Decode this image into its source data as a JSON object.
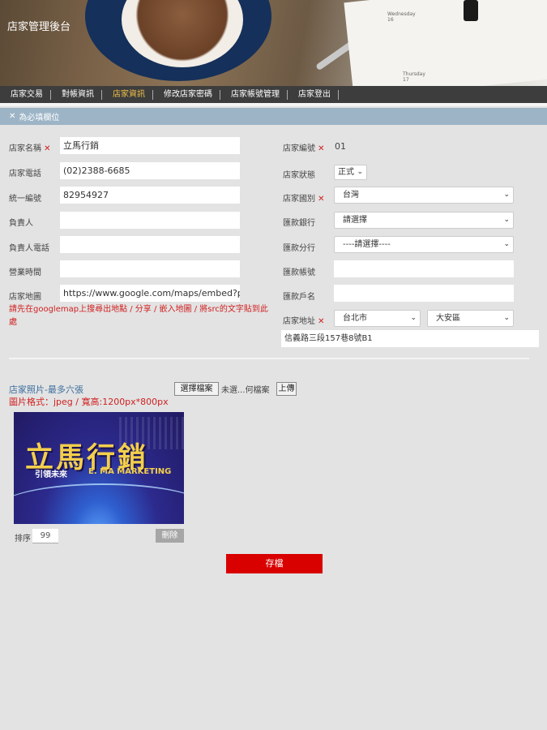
{
  "header": {
    "site_title": "店家管理後台",
    "calendar_text_1": "Wednesday\n16",
    "calendar_text_2": "Thursday\n17"
  },
  "nav": {
    "items": [
      {
        "label": "店家交易",
        "active": false
      },
      {
        "label": "對帳資訊",
        "active": false
      },
      {
        "label": "店家資訊",
        "active": true
      },
      {
        "label": "修改店家密碼",
        "active": false
      },
      {
        "label": "店家帳號管理",
        "active": false
      },
      {
        "label": "店家登出",
        "active": false
      }
    ]
  },
  "required_note": {
    "star": "✕",
    "text": "為必填欄位"
  },
  "form": {
    "store_name": {
      "label": "店家名稱",
      "value": "立馬行銷",
      "required": true
    },
    "store_phone": {
      "label": "店家電話",
      "value": "(02)2388-6685"
    },
    "tax_id": {
      "label": "統一編號",
      "value": "82954927"
    },
    "owner": {
      "label": "負責人",
      "value": ""
    },
    "owner_phone": {
      "label": "負責人電話",
      "value": ""
    },
    "hours": {
      "label": "營業時間",
      "value": ""
    },
    "map": {
      "label": "店家地圖",
      "value": "https://www.google.com/maps/embed?pb"
    },
    "map_note": "請先在googlemap上搜尋出地點 / 分享 / 嵌入地圖 / 將src的文字貼到此處",
    "store_no": {
      "label": "店家編號",
      "value": "01",
      "required": true
    },
    "status": {
      "label": "店家狀態",
      "value": "正式"
    },
    "country": {
      "label": "店家國別",
      "value": "台灣",
      "required": true
    },
    "bank": {
      "label": "匯款銀行",
      "value": "請選擇"
    },
    "branch": {
      "label": "匯款分行",
      "value": "----請選擇----"
    },
    "account_no": {
      "label": "匯款帳號",
      "value": ""
    },
    "account_name": {
      "label": "匯款戶名",
      "value": ""
    },
    "address": {
      "label": "店家地址",
      "city": "台北市",
      "district": "大安區",
      "street": "信義路三段157巷8號B1",
      "required": true
    }
  },
  "photos": {
    "label": "店家照片-最多六張",
    "format": "圖片格式：jpeg / 寬高:1200px*800px",
    "choose_button": "選擇檔案",
    "no_file": "未選...何檔案",
    "upload_button": "上傳",
    "image_title": "立馬行銷",
    "image_sub_white": "引領未來",
    "image_sub_yellow": "E. MA MARKETING",
    "sort_label": "排序",
    "sort_value": "99",
    "delete_button": "刪除"
  },
  "save_button": "存檔",
  "colors": {
    "nav_bg": "#3d3d3d",
    "nav_active": "#f0c04a",
    "required_bar": "#9cb4c6",
    "required_red": "#d02020",
    "save_red": "#d90000",
    "page_bg": "#e3e3e3"
  }
}
